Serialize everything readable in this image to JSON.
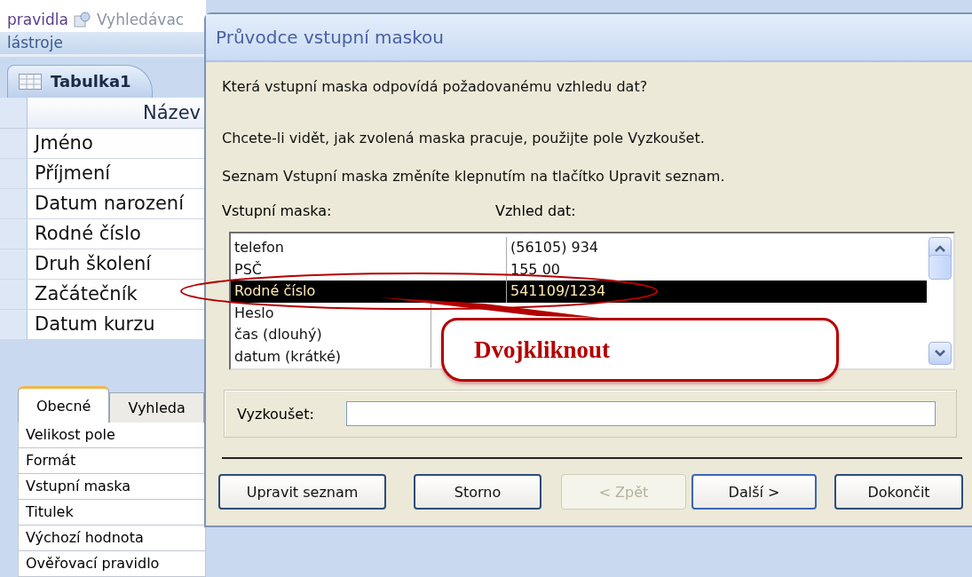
{
  "ribbon": {
    "items": [
      "pravidla",
      "Vyhledávac"
    ],
    "group_label": "lástroje"
  },
  "document_tab": {
    "label": "Tabulka1",
    "selected": true
  },
  "table": {
    "column": "Název",
    "rows": [
      "Jméno",
      "Příjmení",
      "Datum narození",
      "Rodné číslo",
      "Druh školení",
      "Začátečník",
      "Datum kurzu"
    ]
  },
  "properties": {
    "tabs": [
      {
        "label": "Obecné",
        "selected": true
      },
      {
        "label": "Vyhleda",
        "selected": false
      }
    ],
    "rows": [
      "Velikost pole",
      "Formát",
      "Vstupní maska",
      "Titulek",
      "Výchozí hodnota",
      "Ověřovací pravidlo"
    ]
  },
  "dialog": {
    "title": "Průvodce vstupní maskou",
    "paragraphs": [
      "Která vstupní maska odpovídá požadovanému vzhledu dat?",
      "Chcete-li vidět, jak zvolená maska pracuje, použijte pole Vyzkoušet.",
      "Seznam Vstupní maska změníte klepnutím na tlačítko Upravit seznam."
    ],
    "columns": [
      "Vstupní maska:",
      "Vzhled dat:"
    ],
    "masks": [
      {
        "name": "telefon",
        "appearance": "(56105) 934",
        "selected": false
      },
      {
        "name": "PSČ",
        "appearance": "155 00",
        "selected": false
      },
      {
        "name": "Rodné číslo",
        "appearance": "541109/1234",
        "selected": true
      },
      {
        "name": "Heslo",
        "selected": false
      },
      {
        "name": "čas (dlouhý)",
        "selected": false
      },
      {
        "name": "datum (krátké)",
        "selected": false
      }
    ],
    "test": {
      "label": "Vyzkoušet:"
    },
    "buttons": [
      {
        "label": "Upravit seznam",
        "disabled": false,
        "default": false
      },
      {
        "label": "Storno",
        "disabled": false,
        "default": false
      },
      {
        "label": "< Zpět",
        "disabled": true,
        "default": false
      },
      {
        "label": "Další >",
        "disabled": false,
        "default": true
      },
      {
        "label": "Dokončit",
        "disabled": false,
        "default": false
      }
    ]
  },
  "annotation": {
    "text": "Dvojkliknout"
  }
}
